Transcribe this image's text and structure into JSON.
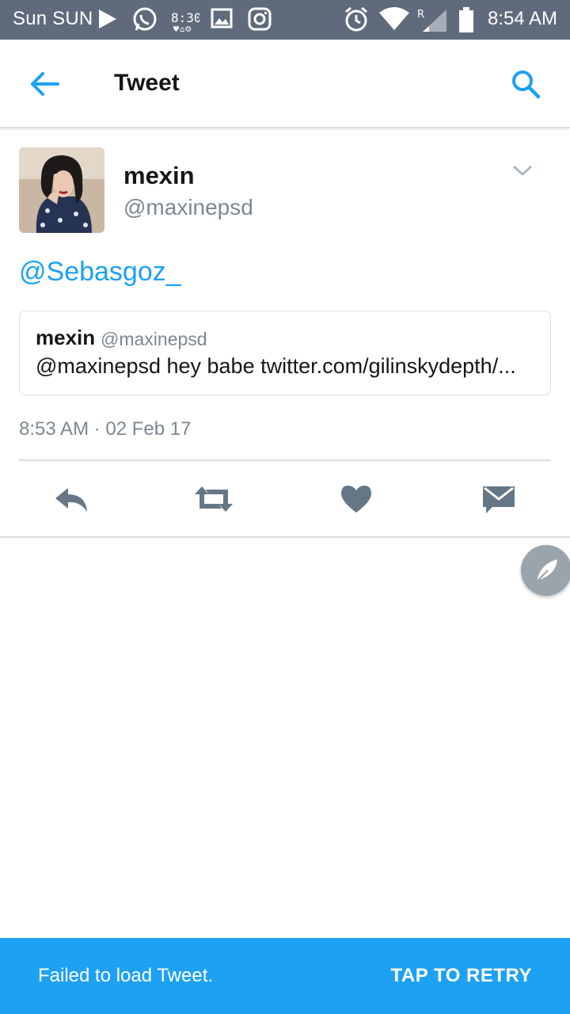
{
  "status_bar": {
    "carrier": "Sun SUN",
    "time": "8:54 AM",
    "icons": [
      "play-icon",
      "whatsapp-icon",
      "clock-widget-icon",
      "gallery-icon",
      "instagram-icon",
      "alarm-icon",
      "wifi-icon",
      "signal-roaming-icon",
      "battery-icon"
    ]
  },
  "app_bar": {
    "title": "Tweet"
  },
  "tweet": {
    "display_name": "mexin",
    "handle": "@maxinepsd",
    "text": "@Sebasgoz_",
    "quoted": {
      "display_name": "mexin",
      "handle": "@maxinepsd",
      "text": "@maxinepsd hey babe twitter.com/gilinskydepth/..."
    },
    "timestamp": "8:53 AM · 02 Feb 17"
  },
  "colors": {
    "accent": "#1da1f2",
    "status_bar": "#5f6b7c",
    "icon_gray": "#657786"
  },
  "snackbar": {
    "message": "Failed to load Tweet.",
    "action": "TAP TO RETRY"
  }
}
